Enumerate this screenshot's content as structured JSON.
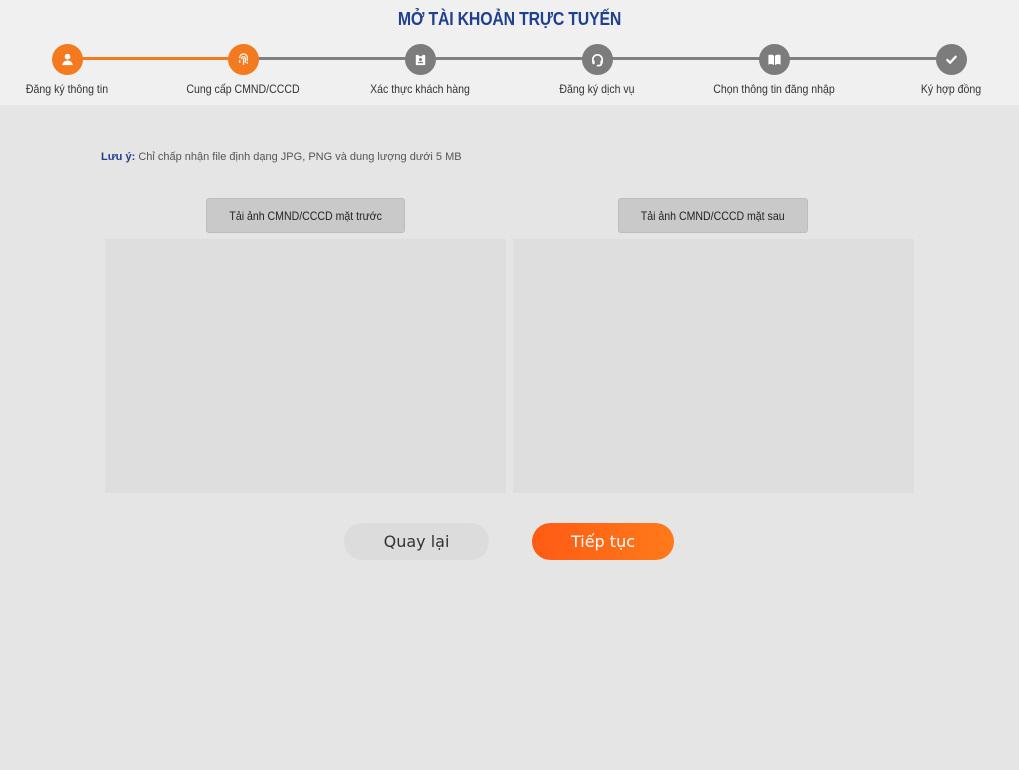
{
  "header": {
    "title": "MỞ TÀI KHOẢN TRỰC TUYẾN"
  },
  "steps": [
    {
      "label": "Đăng ký thông tin",
      "icon": "user-icon",
      "status": "completed"
    },
    {
      "label": "Cung cấp CMND/CCCD",
      "icon": "fingerprint-icon",
      "status": "current"
    },
    {
      "label": "Xác thực khách hàng",
      "icon": "id-badge-icon",
      "status": "pending"
    },
    {
      "label": "Đăng ký dịch vụ",
      "icon": "headset-icon",
      "status": "pending"
    },
    {
      "label": "Chọn thông tin đăng nhập",
      "icon": "book-icon",
      "status": "pending"
    },
    {
      "label": "Ký hợp đồng",
      "icon": "check-icon",
      "status": "pending"
    }
  ],
  "note": {
    "key": "Lưu ý:",
    "text": "Chỉ chấp nhận file định dạng JPG, PNG và dung lượng dưới 5 MB"
  },
  "upload": {
    "front_label": "Tải ảnh CMND/CCCD mặt trước",
    "back_label": "Tải ảnh CMND/CCCD mặt sau"
  },
  "actions": {
    "back_label": "Quay lại",
    "next_label": "Tiếp tục"
  },
  "colors": {
    "accent": "#f47a1f",
    "title": "#1f3f8f",
    "inactive": "#7c7c7c"
  }
}
